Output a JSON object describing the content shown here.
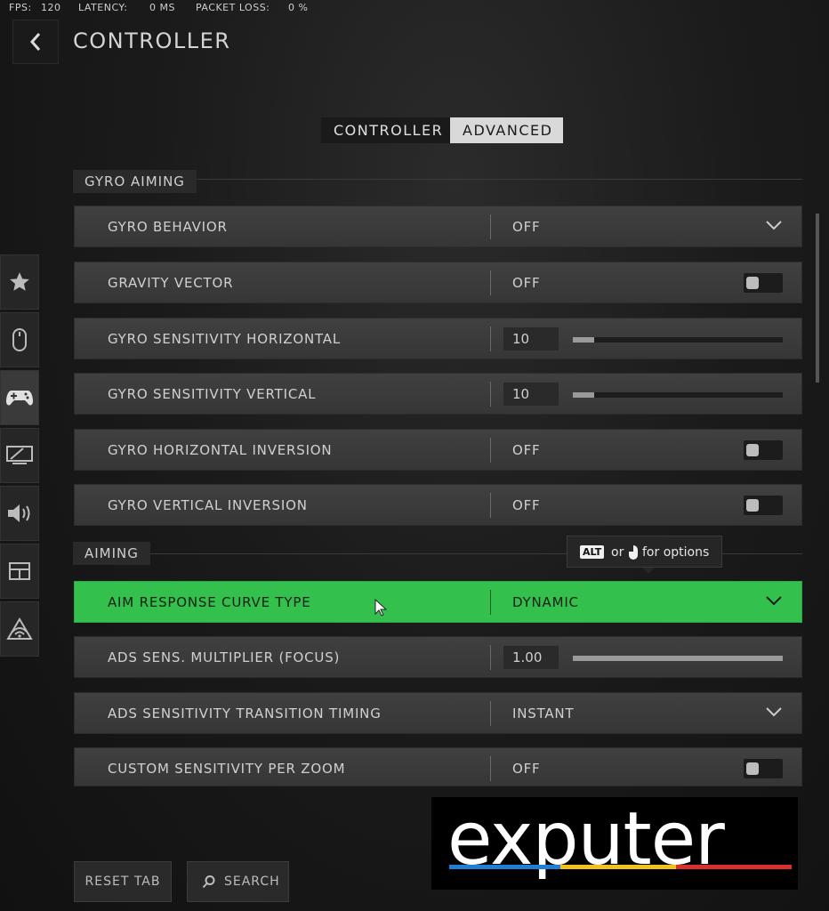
{
  "stats": {
    "fps_label": "FPS:",
    "fps_value": "120",
    "latency_label": "LATENCY:",
    "latency_value": "0 MS",
    "packet_label": "PACKET LOSS:",
    "packet_value": "0 %"
  },
  "header": {
    "title": "CONTROLLER"
  },
  "tabs": [
    {
      "label": "CONTROLLER",
      "active": false
    },
    {
      "label": "ADVANCED",
      "active": true
    }
  ],
  "sections": {
    "gyro": "GYRO AIMING",
    "aiming": "AIMING"
  },
  "sidenav": [
    {
      "icon": "star-icon"
    },
    {
      "icon": "mouse-icon"
    },
    {
      "icon": "gamepad-icon",
      "active": true
    },
    {
      "icon": "display-icon"
    },
    {
      "icon": "speaker-icon"
    },
    {
      "icon": "interface-icon"
    },
    {
      "icon": "network-icon"
    }
  ],
  "rows": {
    "gyro_behavior": {
      "label": "GYRO BEHAVIOR",
      "value": "OFF",
      "control": "dropdown"
    },
    "gravity_vector": {
      "label": "GRAVITY VECTOR",
      "value": "OFF",
      "control": "toggle"
    },
    "gyro_sens_h": {
      "label": "GYRO SENSITIVITY HORIZONTAL",
      "value": "10",
      "control": "slider",
      "fraction": 0.1
    },
    "gyro_sens_v": {
      "label": "GYRO SENSITIVITY VERTICAL",
      "value": "10",
      "control": "slider",
      "fraction": 0.1
    },
    "gyro_h_inv": {
      "label": "GYRO HORIZONTAL INVERSION",
      "value": "OFF",
      "control": "toggle"
    },
    "gyro_v_inv": {
      "label": "GYRO VERTICAL INVERSION",
      "value": "OFF",
      "control": "toggle"
    },
    "aim_curve": {
      "label": "AIM RESPONSE CURVE TYPE",
      "value": "DYNAMIC",
      "control": "dropdown",
      "highlighted": true
    },
    "ads_mult": {
      "label": "ADS SENS. MULTIPLIER (FOCUS)",
      "value": "1.00",
      "control": "slider",
      "fraction": 1.0
    },
    "ads_timing": {
      "label": "ADS SENSITIVITY TRANSITION TIMING",
      "value": "INSTANT",
      "control": "dropdown"
    },
    "custom_zoom": {
      "label": "CUSTOM SENSITIVITY PER ZOOM",
      "value": "OFF",
      "control": "toggle"
    }
  },
  "tooltip": {
    "key": "ALT",
    "or": "or",
    "text": "for options"
  },
  "buttons": {
    "reset": "RESET TAB",
    "search": "SEARCH"
  },
  "watermark": {
    "text": "exputer"
  },
  "colors": {
    "highlight": "#34c04c",
    "watermark_blue": "#1f7fd6",
    "watermark_yellow": "#f2c21b",
    "watermark_red": "#d8312b"
  }
}
